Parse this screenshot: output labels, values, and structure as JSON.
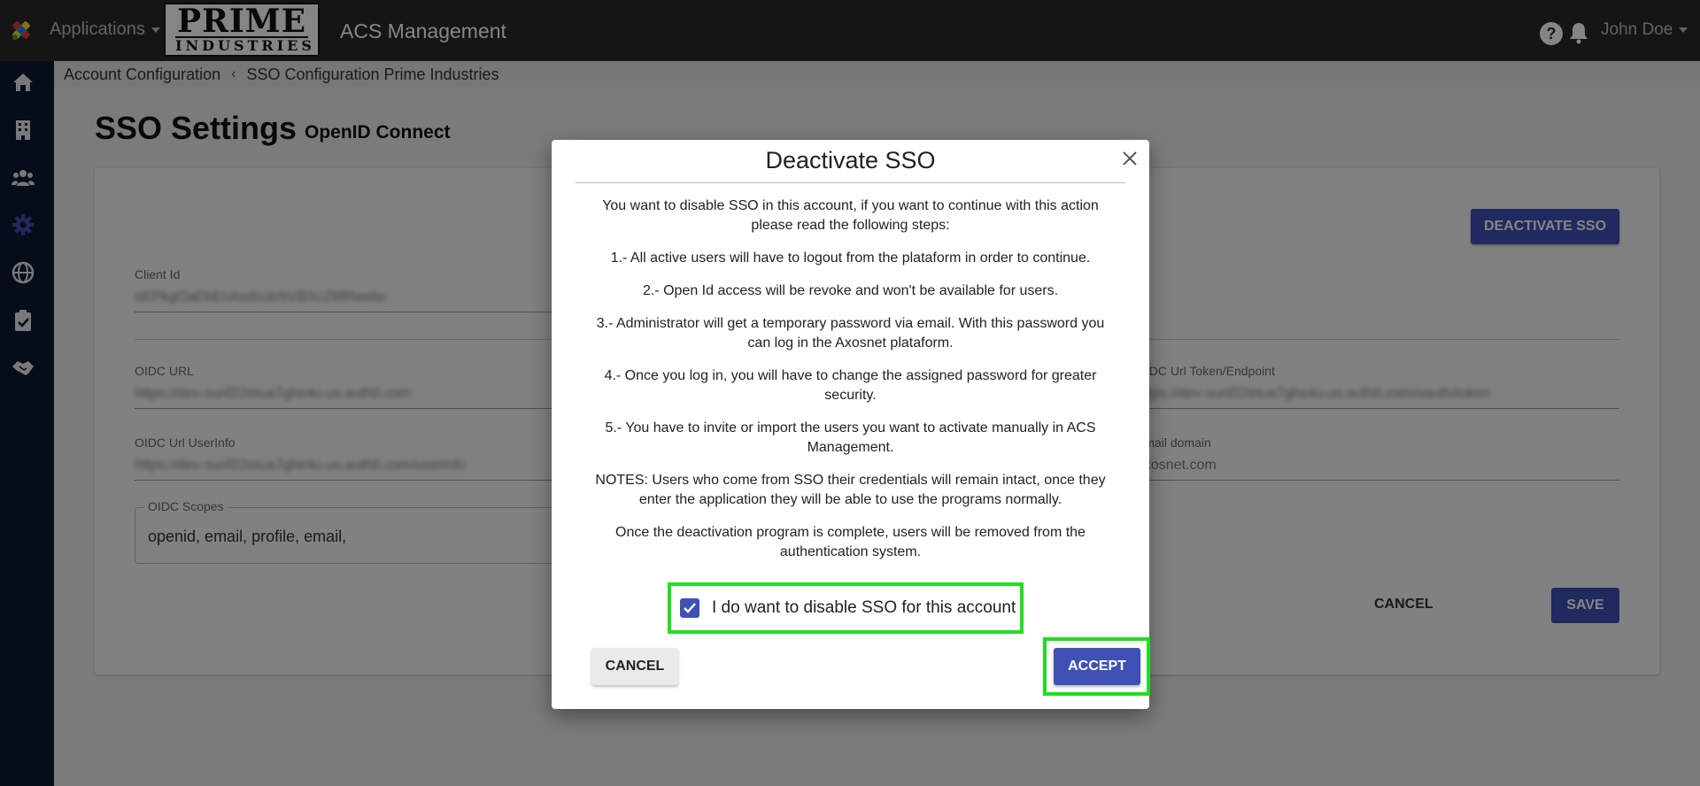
{
  "topbar": {
    "apps_label": "Applications",
    "brand_big": "PRIME",
    "brand_small": "INDUSTRIES",
    "app_title": "ACS Management",
    "help_glyph": "?",
    "user_name": "John Doe"
  },
  "sidebar": {
    "items": [
      {
        "icon": "home-icon"
      },
      {
        "icon": "building-icon"
      },
      {
        "icon": "users-icon"
      },
      {
        "icon": "gear-icon",
        "active": true
      },
      {
        "icon": "globe-icon"
      },
      {
        "icon": "clipboard-check-icon"
      },
      {
        "icon": "handshake-icon"
      }
    ],
    "active_color": "#3f51b5"
  },
  "breadcrumb": {
    "items": [
      "Account Configuration",
      "SSO Configuration Prime Industries"
    ],
    "separator": "‹"
  },
  "page": {
    "title": "SSO Settings",
    "subtitle": "OpenID Connect",
    "deactivate_label": "DEACTIVATE SSO",
    "fields": {
      "client_id": {
        "label": "Client Id",
        "value": "eEPkgOaEbEnAsdcckrbVBXcZ8fRwebc"
      },
      "oidc_url": {
        "label": "OIDC URL",
        "value": "https://dev-sunf22etua7ghe4u.us.auth0.com"
      },
      "oidc_token": {
        "label": "OIDC Url Token/Endpoint",
        "value": "https://dev-sunf22etua7ghe4u.us.auth0.com/oauth/token"
      },
      "oidc_userinfo": {
        "label": "OIDC Url UserInfo",
        "value": "https://dev-sunf22etua7ghe4u.us.auth0.com/userinfo"
      },
      "email_domain": {
        "label": "Email domain",
        "value": "axosnet.com"
      },
      "scopes": {
        "label": "OIDC Scopes",
        "value": "openid, email, profile, email,"
      }
    },
    "cancel_label": "CANCEL",
    "save_label": "SAVE"
  },
  "modal": {
    "title": "Deactivate SSO",
    "intro": "You want to disable SSO in this account, if you want to continue with this action please read the following steps:",
    "steps": [
      "1.- All active users will have to logout from the plataform in order to continue.",
      "2.- Open Id access will be revoke and won't be available for users.",
      "3.- Administrator will get a temporary password via email. With this password you can log in the Axosnet plataform.",
      "4.- Once you log in, you will have to change the assigned password for greater security.",
      "5.- You have to invite or import the users you want to activate manually in ACS Management."
    ],
    "notes": "NOTES: Users who come from SSO their credentials will remain intact, once they enter the application they will be able to use the programs normally.",
    "closing": "Once the deactivation program is complete, users will be removed from the authentication system.",
    "confirm_label": "I do want to disable SSO for this account",
    "confirm_checked": true,
    "cancel_label": "CANCEL",
    "accept_label": "ACCEPT",
    "highlight_color": "#22dd22",
    "primary_color": "#3f51b5"
  }
}
